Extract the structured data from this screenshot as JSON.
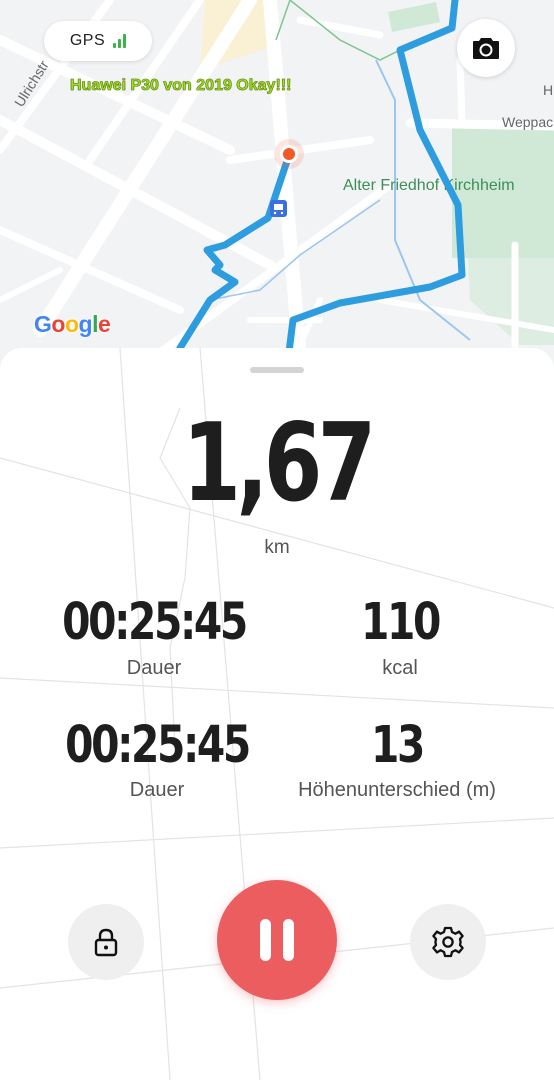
{
  "map": {
    "gps_label": "GPS",
    "signal_level": 3,
    "overlay_caption": "Huawei P30 von 2019 Okay!!!",
    "street_labels": [
      "Ulrichstr",
      "Weppac",
      "Alter Friedhof Kirchheim",
      "H"
    ],
    "logo_text": "Google",
    "camera_icon": "camera-icon",
    "colors": {
      "route": "#2e9de0",
      "location_marker": "#f05a28",
      "park": "#c8e6cf",
      "water": "#9cc5f0"
    }
  },
  "summary": {
    "distance_value": "1,67",
    "distance_unit": "km"
  },
  "stats": [
    {
      "value": "00:25:45",
      "label": "Dauer"
    },
    {
      "value": "110",
      "label": "kcal"
    },
    {
      "value": "00:25:45",
      "label": "Dauer"
    },
    {
      "value": "13",
      "label": "Höhenunterschied (m)"
    }
  ],
  "controls": {
    "lock_icon": "lock-icon",
    "pause_icon": "pause-icon",
    "settings_icon": "gear-icon",
    "colors": {
      "pause": "#ec5d60",
      "secondary_bg": "#efefef"
    }
  }
}
